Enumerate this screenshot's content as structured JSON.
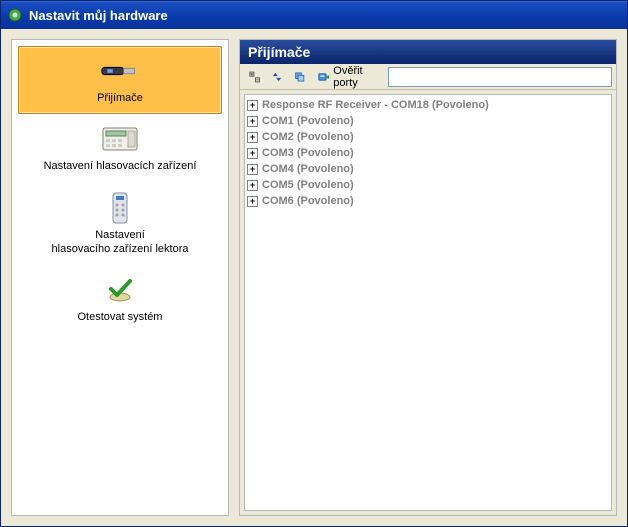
{
  "window": {
    "title": "Nastavit můj hardware"
  },
  "sidebar": {
    "items": [
      {
        "label": "Přijímače"
      },
      {
        "label": "Nastavení hlasovacích zařízení"
      },
      {
        "label": "Nastavení\nhlasovacího zařízení lektora"
      },
      {
        "label": "Otestovat systém"
      }
    ]
  },
  "panel": {
    "title": "Přijímače"
  },
  "toolbar": {
    "verify_label": "Ověřit porty",
    "input_value": ""
  },
  "tree": {
    "items": [
      {
        "label": "Response RF Receiver - COM18 (Povoleno)",
        "bold": true
      },
      {
        "label": "COM1 (Povoleno)",
        "bold": true
      },
      {
        "label": "COM2 (Povoleno)",
        "bold": true
      },
      {
        "label": "COM3 (Povoleno)",
        "bold": true
      },
      {
        "label": "COM4 (Povoleno)",
        "bold": true
      },
      {
        "label": "COM5 (Povoleno)",
        "bold": true
      },
      {
        "label": "COM6 (Povoleno)",
        "bold": true
      }
    ]
  }
}
